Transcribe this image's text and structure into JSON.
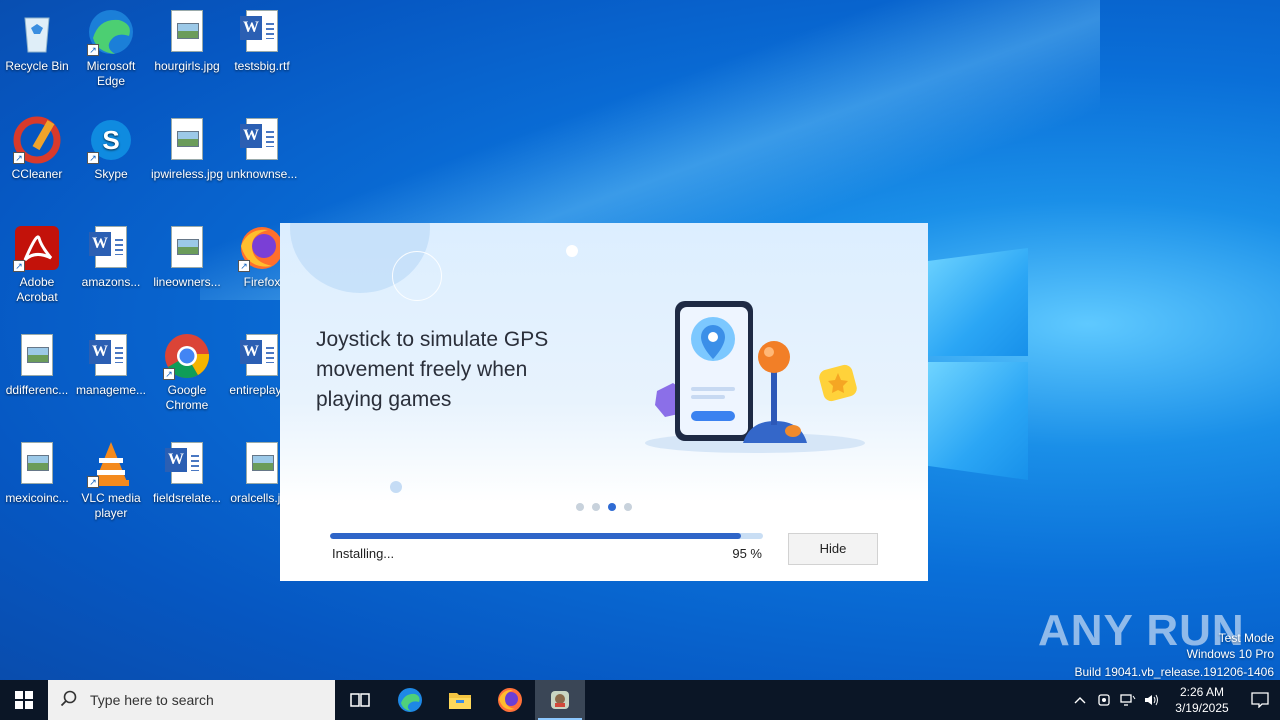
{
  "desktop": {
    "icons": [
      {
        "label": "Recycle Bin",
        "icon": "recycle-bin-icon"
      },
      {
        "label": "Microsoft Edge",
        "icon": "edge-icon"
      },
      {
        "label": "hourgirls.jpg",
        "icon": "image-file-icon"
      },
      {
        "label": "testsbig.rtf",
        "icon": "word-document-icon"
      },
      {
        "label": "CCleaner",
        "icon": "ccleaner-icon"
      },
      {
        "label": "Skype",
        "icon": "skype-icon"
      },
      {
        "label": "ipwireless.jpg",
        "icon": "image-file-icon"
      },
      {
        "label": "unknownse...",
        "icon": "word-document-icon"
      },
      {
        "label": "Adobe Acrobat",
        "icon": "acrobat-icon"
      },
      {
        "label": "amazons...",
        "icon": "word-document-icon"
      },
      {
        "label": "lineowners...",
        "icon": "image-file-icon"
      },
      {
        "label": "Firefox",
        "icon": "firefox-icon"
      },
      {
        "label": "ddifferenc...",
        "icon": "image-file-icon"
      },
      {
        "label": "manageme...",
        "icon": "word-document-icon"
      },
      {
        "label": "Google Chrome",
        "icon": "chrome-icon"
      },
      {
        "label": "entireplay.rtf",
        "icon": "word-document-icon"
      },
      {
        "label": "mexicoinc...",
        "icon": "image-file-icon"
      },
      {
        "label": "VLC media player",
        "icon": "vlc-icon"
      },
      {
        "label": "fieldsrelate...",
        "icon": "word-document-icon"
      },
      {
        "label": "oralcells.jpg",
        "icon": "image-file-icon"
      }
    ]
  },
  "installer": {
    "headline": "Joystick to simulate GPS movement freely when playing games",
    "slide_count": 4,
    "active_slide": 3,
    "progress_percent": 95,
    "status_text": "Installing...",
    "percent_text": "95 %",
    "hide_label": "Hide",
    "accent_color": "#2f65c8"
  },
  "watermark": {
    "logo": "ANY RUN",
    "mode": "Test Mode",
    "edition": "Windows 10 Pro",
    "build": "Build 19041.vb_release.191206-1406"
  },
  "taskbar": {
    "search_placeholder": "Type here to search",
    "pinned": [
      "task-view-icon",
      "edge-icon",
      "file-explorer-icon",
      "firefox-icon",
      "installer-app-icon"
    ],
    "time": "2:26 AM",
    "date": "3/19/2025"
  }
}
